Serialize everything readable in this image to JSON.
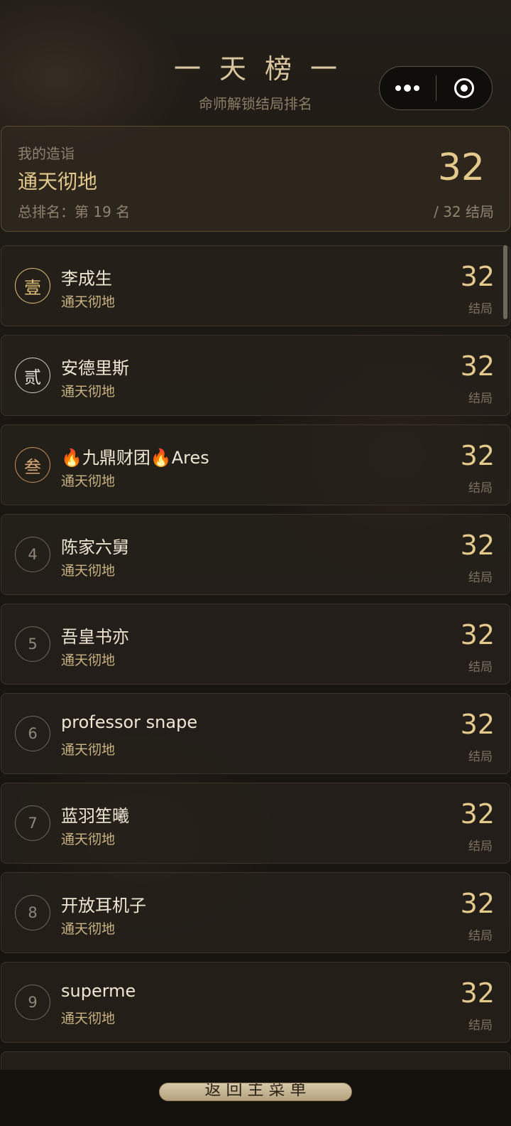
{
  "header": {
    "title": "一天榜一",
    "subtitle": "命师解锁结局排名"
  },
  "my_card": {
    "label": "我的造诣",
    "title": "通天彻地",
    "rank_text": "总排名：第 19 名",
    "score": "32",
    "total_text": "/ 32 结局"
  },
  "leaderboard": {
    "unit_label": "结局",
    "rows": [
      {
        "rank": "壹",
        "name": "李成生",
        "title": "通天彻地",
        "score": "32"
      },
      {
        "rank": "贰",
        "name": "安德里斯",
        "title": "通天彻地",
        "score": "32"
      },
      {
        "rank": "叁",
        "name": "🔥九鼎财团🔥Ares",
        "title": "通天彻地",
        "score": "32"
      },
      {
        "rank": "4",
        "name": "陈家六舅",
        "title": "通天彻地",
        "score": "32"
      },
      {
        "rank": "5",
        "name": "吾皇书亦",
        "title": "通天彻地",
        "score": "32"
      },
      {
        "rank": "6",
        "name": "professor snape",
        "title": "通天彻地",
        "score": "32"
      },
      {
        "rank": "7",
        "name": "蓝羽笙曦",
        "title": "通天彻地",
        "score": "32"
      },
      {
        "rank": "8",
        "name": "开放耳机子",
        "title": "通天彻地",
        "score": "32"
      },
      {
        "rank": "9",
        "name": "superme",
        "title": "通天彻地",
        "score": "32"
      }
    ]
  },
  "footer": {
    "back_label": "返回主菜单"
  },
  "icons": {
    "more": "more-dots-icon",
    "close": "close-target-icon"
  },
  "colors": {
    "gold": "#e3c98c",
    "background": "#1b1712"
  }
}
